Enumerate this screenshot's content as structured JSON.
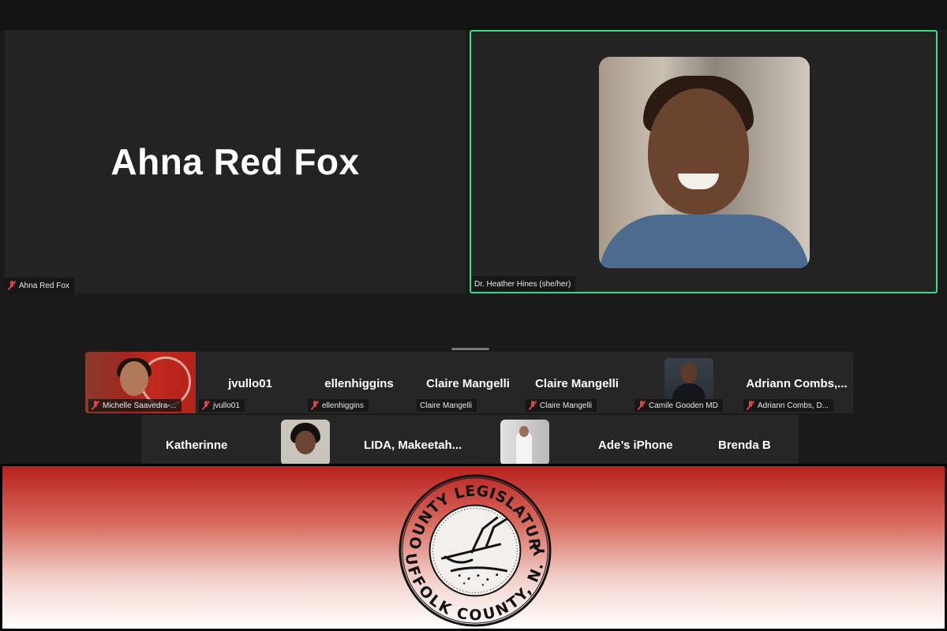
{
  "meeting": {
    "main_tiles": [
      {
        "display_name": "Ahna Red Fox",
        "tag": "Ahna Red Fox",
        "muted": true
      },
      {
        "tag": "Dr. Heather Hines (she/her)",
        "muted": false,
        "active_speaker": true
      }
    ],
    "strip_row_1": [
      {
        "tag": "Michelle Saavedra-...",
        "muted": true,
        "has_video": true
      },
      {
        "display_name": "jvullo01",
        "tag": "jvullo01",
        "muted": true
      },
      {
        "display_name": "ellenhiggins",
        "tag": "ellenhiggins",
        "muted": true
      },
      {
        "display_name": "Claire Mangelli",
        "tag": "Claire Mangelli",
        "muted": false
      },
      {
        "display_name": "Claire Mangelli",
        "tag": "Claire Mangelli",
        "muted": true
      },
      {
        "tag": "Camile Gooden MD",
        "muted": true,
        "has_video": true
      },
      {
        "display_name": "Adriann  Combs,...",
        "tag": "Adriann Combs, D...",
        "muted": true
      }
    ],
    "strip_row_2": [
      {
        "display_name": "Katherinne"
      },
      {
        "has_video": true
      },
      {
        "display_name": "LIDA,  Makeetah..."
      },
      {
        "has_video": true
      },
      {
        "display_name": "Ade’s iPhone"
      },
      {
        "display_name": "Brenda B"
      }
    ]
  },
  "banner": {
    "seal_top_text": "COUNTY LEGISLATURE",
    "seal_bottom_text": "SUFFOLK COUNTY, N. Y.",
    "colors": {
      "top": "#b8201e",
      "bottom": "#ffffff"
    }
  },
  "colors": {
    "active_border": "#3ddc84",
    "mic_muted": "#d64545",
    "tile_bg": "#232323"
  }
}
